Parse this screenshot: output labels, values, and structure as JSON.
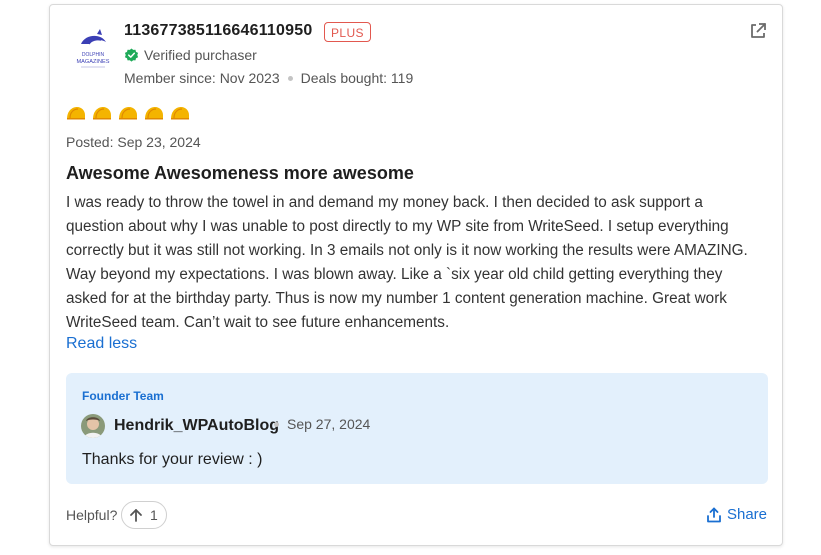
{
  "review": {
    "username": "113677385116646110950",
    "badge": "PLUS",
    "verified_label": "Verified purchaser",
    "member_since": "Member since: Nov 2023",
    "deals_bought": "Deals bought: 119",
    "avatar_text": [
      "DOLPHIN",
      "MAGAZINES"
    ],
    "rating": 5,
    "rating_max": 5,
    "posted": "Posted: Sep 23, 2024",
    "title": "Awesome Awesomeness more awesome",
    "body": "I was ready to throw the towel in and demand my money back. I then decided to ask support a question about why I was unable to post directly to my WP site from WriteSeed. I setup everything correctly but it was still not working. In 3 emails not only is it now working the results were AMAZING. Way beyond my expectations. I was blown away. Like a `six year old child getting everything they asked for at the birthday party. Thus is now my number 1 content generation machine. Great work WriteSeed team. Can’t wait to see future enhancements.",
    "read_less": "Read less"
  },
  "reply": {
    "team_label": "Founder Team",
    "author": "Hendrik_WPAutoBlog",
    "date": "Sep 27, 2024",
    "text": "Thanks for your review : )"
  },
  "footer": {
    "helpful_label": "Helpful?",
    "helpful_count": "1",
    "share_label": "Share"
  },
  "colors": {
    "accent": "#1a6fd1",
    "plus_badge": "#e2584f",
    "verified_green": "#1faa59",
    "taco": "#f4b400",
    "reply_bg": "#e3f0fc"
  },
  "icons": {
    "external": "external-link-icon",
    "verified": "verified-check-icon",
    "rating": "taco-icon",
    "helpful": "up-arrow-icon",
    "share": "share-icon"
  }
}
